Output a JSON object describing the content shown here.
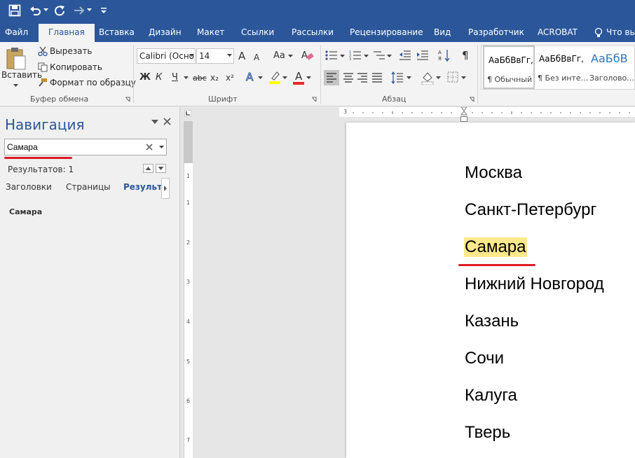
{
  "quick_access": {
    "save_icon": "save-icon",
    "undo_icon": "undo-icon",
    "redo_icon": "redo-icon",
    "touch_icon": "touch-mode-icon",
    "customize_icon": "customize-qat-icon"
  },
  "ribbon_tabs": [
    "Файл",
    "Главная",
    "Вставка",
    "Дизайн",
    "Макет",
    "Ссылки",
    "Рассылки",
    "Рецензирование",
    "Вид",
    "Разработчик",
    "ACROBAT"
  ],
  "active_tab": "Главная",
  "tell_me": "Что вы",
  "clipboard": {
    "paste_label": "Вставить",
    "cut_label": "Вырезать",
    "copy_label": "Копировать",
    "format_painter_label": "Формат по образцу",
    "group_label": "Буфер обмена"
  },
  "font": {
    "font_name": "Calibri (Осно",
    "font_size": "14",
    "grow_glyph": "A",
    "shrink_glyph": "A",
    "change_case_glyph": "Aa",
    "bold_glyph": "Ж",
    "italic_glyph": "К",
    "underline_glyph": "Ч",
    "strike_glyph": "abc",
    "subscript_glyph": "x₂",
    "superscript_glyph": "x²",
    "font_color_glyph": "A",
    "group_label": "Шрифт"
  },
  "paragraph": {
    "show_marks_glyph": "¶",
    "group_label": "Абзац"
  },
  "styles": {
    "items": [
      {
        "sample": "АаБбВвГг,",
        "name": "¶ Обычный"
      },
      {
        "sample": "АаБбВвГг,",
        "name": "¶ Без инте..."
      },
      {
        "sample": "АаБбВ",
        "name": "Заголово..."
      }
    ]
  },
  "navigation": {
    "title": "Навигация",
    "search_value": "Самара",
    "results_text": "Результатов: 1",
    "tabs": [
      "Заголовки",
      "Страницы",
      "Результат"
    ],
    "active_tab": "Результат",
    "result_item": "Самара"
  },
  "vertical_ruler_numbers": [
    "1",
    "1",
    "2",
    "3",
    "4",
    "5",
    "6",
    "7"
  ],
  "horizontal_ruler_number": "3",
  "document": {
    "lines": [
      "Москва",
      "Санкт-Петербург",
      "Самара",
      "Нижний Новгород",
      "Казань",
      "Сочи",
      "Калуга",
      "Тверь"
    ],
    "highlighted_line": "Самара",
    "highlight_color": "#fde98b"
  },
  "colors": {
    "brand": "#2b579a",
    "annotation_red": "#e01b24"
  }
}
